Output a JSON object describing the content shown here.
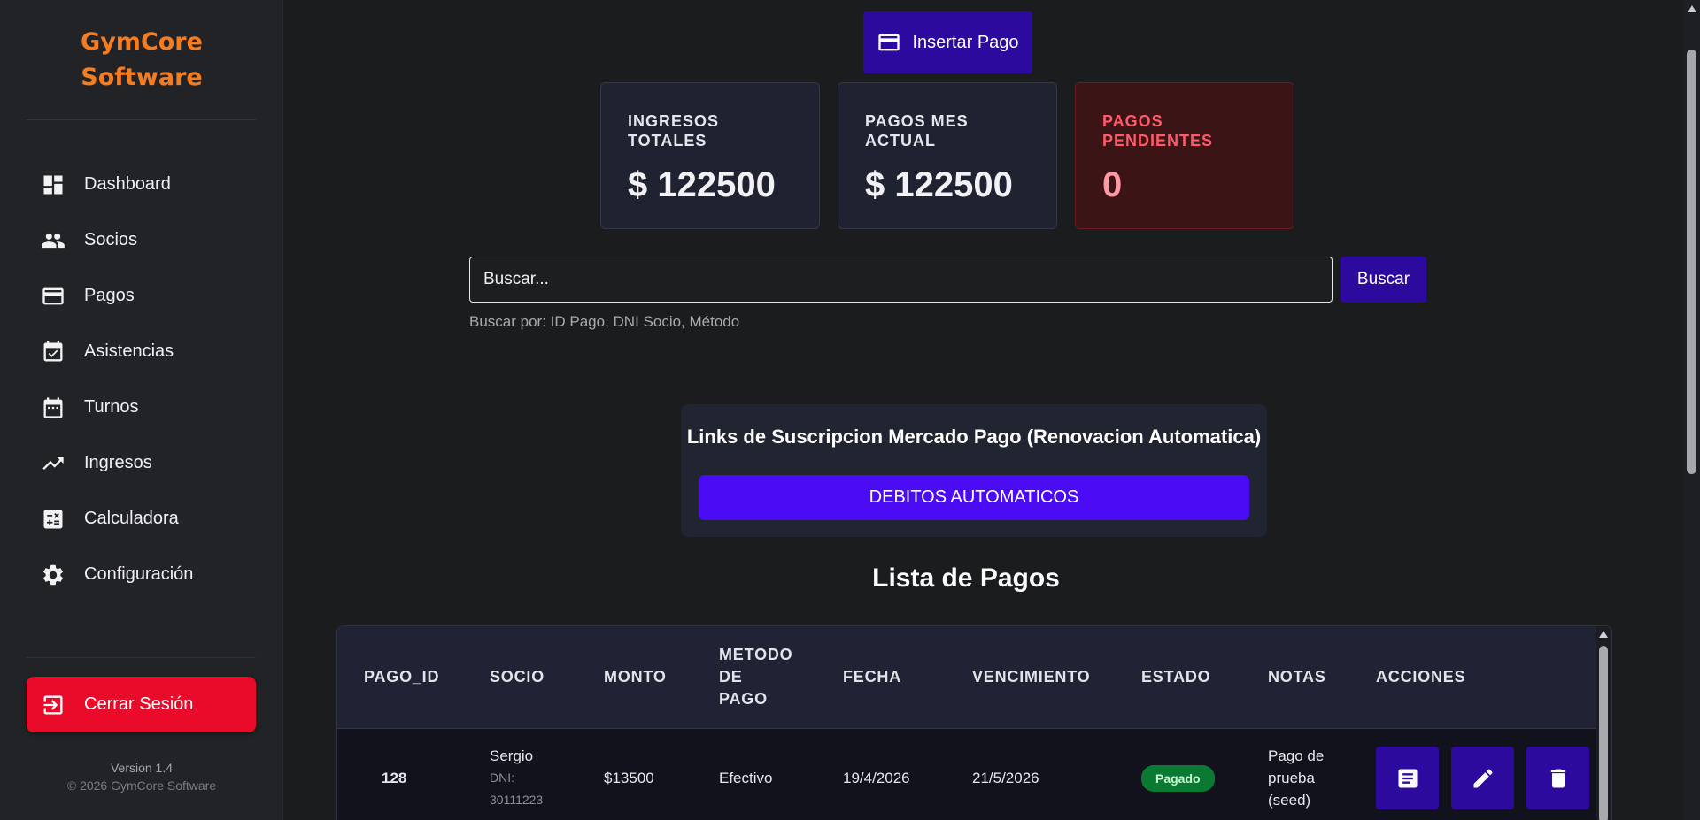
{
  "sidebar": {
    "brand": {
      "line1": "GymCore",
      "line2": "Software",
      "color": "#f57c1f"
    },
    "items": [
      {
        "label": "Dashboard",
        "icon": "dashboard-icon"
      },
      {
        "label": "Socios",
        "icon": "people-icon"
      },
      {
        "label": "Pagos",
        "icon": "credit-card-icon"
      },
      {
        "label": "Asistencias",
        "icon": "calendar-check-icon"
      },
      {
        "label": "Turnos",
        "icon": "calendar-icon"
      },
      {
        "label": "Ingresos",
        "icon": "trending-up-icon"
      },
      {
        "label": "Calculadora",
        "icon": "calculator-icon"
      },
      {
        "label": "Configuración",
        "icon": "gear-icon"
      }
    ],
    "logout_label": "Cerrar Sesión",
    "logout_color": "#ea0a2a",
    "version": "Version 1.4",
    "copyright": "© 2026 GymCore Software"
  },
  "main": {
    "insert_button": "Insertar Pago",
    "stats": [
      {
        "label": "INGRESOS TOTALES",
        "value": "$ 122500"
      },
      {
        "label": "PAGOS MES ACTUAL",
        "value": "$ 122500"
      },
      {
        "label": "PAGOS PENDIENTES",
        "value": "0"
      }
    ],
    "search": {
      "placeholder": "Buscar...",
      "button": "Buscar",
      "hint": "Buscar por: ID Pago, DNI Socio, Método"
    },
    "links_card": {
      "title": "Links de Suscripcion Mercado Pago (Renovacion Automatica)",
      "button": "DEBITOS AUTOMATICOS"
    },
    "list_title": "Lista de Pagos",
    "table": {
      "headers": {
        "pago_id": "PAGO_ID",
        "socio": "SOCIO",
        "monto": "MONTO",
        "metodo_1": "METODO",
        "metodo_2": "DE",
        "metodo_3": "PAGO",
        "fecha": "FECHA",
        "vencimiento": "VENCIMIENTO",
        "estado": "ESTADO",
        "notas": "NOTAS",
        "acciones": "ACCIONES"
      },
      "rows": [
        {
          "pago_id": "128",
          "socio_nombre": "Sergio",
          "socio_dni_label": "DNI:",
          "socio_dni": "30111223",
          "monto": "$13500",
          "metodo": "Efectivo",
          "fecha": "19/4/2026",
          "vencimiento": "21/5/2026",
          "estado": "Pagado",
          "notas_1": "Pago de",
          "notas_2": "prueba",
          "notas_3": "(seed)",
          "actions": [
            "receipt-icon",
            "edit-icon",
            "delete-icon"
          ]
        }
      ]
    }
  },
  "colors": {
    "accent": "#2c0a9e",
    "bright_accent": "#4b0cf5",
    "success": "#0a7a33",
    "danger": "#ff5a6a"
  }
}
